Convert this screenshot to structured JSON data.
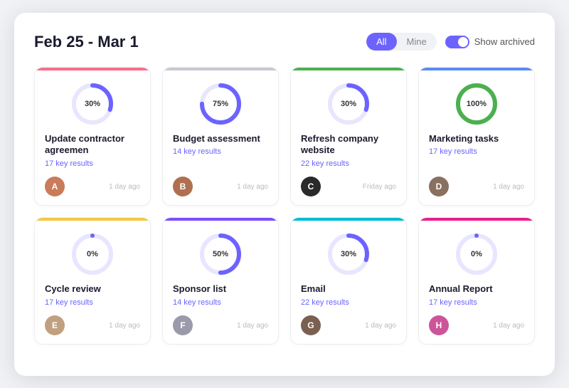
{
  "header": {
    "title": "Feb 25 - Mar 1",
    "filter_all": "All",
    "filter_mine": "Mine",
    "toggle_label": "Show archived"
  },
  "cards": [
    {
      "id": "update-contractor",
      "title": "Update contractor agreemen",
      "key_results": "17 key results",
      "progress": 30,
      "time": "1 day ago",
      "color_class": "red",
      "donut_color": "#6c63ff",
      "donut_bg": "#e8e6ff",
      "avatar_text": "A",
      "avatar_bg": "#c97b5a"
    },
    {
      "id": "budget-assessment",
      "title": "Budget assessment",
      "key_results": "14 key results",
      "progress": 75,
      "time": "1 day ago",
      "color_class": "gray",
      "donut_color": "#6c63ff",
      "donut_bg": "#e8e6ff",
      "avatar_text": "B",
      "avatar_bg": "#b07050"
    },
    {
      "id": "refresh-website",
      "title": "Refresh company website",
      "key_results": "22 key results",
      "progress": 30,
      "time": "Friday ago",
      "color_class": "green",
      "donut_color": "#6c63ff",
      "donut_bg": "#e8e6ff",
      "avatar_text": "C",
      "avatar_bg": "#2a2a2a"
    },
    {
      "id": "marketing-tasks",
      "title": "Marketing tasks",
      "key_results": "17 key results",
      "progress": 100,
      "time": "1 day ago",
      "color_class": "blue-indigo",
      "donut_color": "#4caf50",
      "donut_bg": "#e8f5e9",
      "avatar_text": "D",
      "avatar_bg": "#8a7060"
    },
    {
      "id": "cycle-review",
      "title": "Cycle review",
      "key_results": "17 key results",
      "progress": 0,
      "time": "1 day ago",
      "color_class": "yellow",
      "donut_color": "#6c63ff",
      "donut_bg": "#e8e6ff",
      "avatar_text": "E",
      "avatar_bg": "#c0a080"
    },
    {
      "id": "sponsor-list",
      "title": "Sponsor list",
      "key_results": "14 key results",
      "progress": 50,
      "time": "1 day ago",
      "color_class": "purple",
      "donut_color": "#6c63ff",
      "donut_bg": "#e8e6ff",
      "avatar_text": "F",
      "avatar_bg": "#9a9aaa"
    },
    {
      "id": "email",
      "title": "Email",
      "key_results": "22 key results",
      "progress": 30,
      "time": "1 day ago",
      "color_class": "cyan",
      "donut_color": "#6c63ff",
      "donut_bg": "#e8e6ff",
      "avatar_text": "G",
      "avatar_bg": "#7a6050"
    },
    {
      "id": "annual-report",
      "title": "Annual Report",
      "key_results": "17 key results",
      "progress": 0,
      "time": "1 day ago",
      "color_class": "pink",
      "donut_color": "#6c63ff",
      "donut_bg": "#e8e6ff",
      "avatar_text": "H",
      "avatar_bg": "#cc5599"
    }
  ]
}
